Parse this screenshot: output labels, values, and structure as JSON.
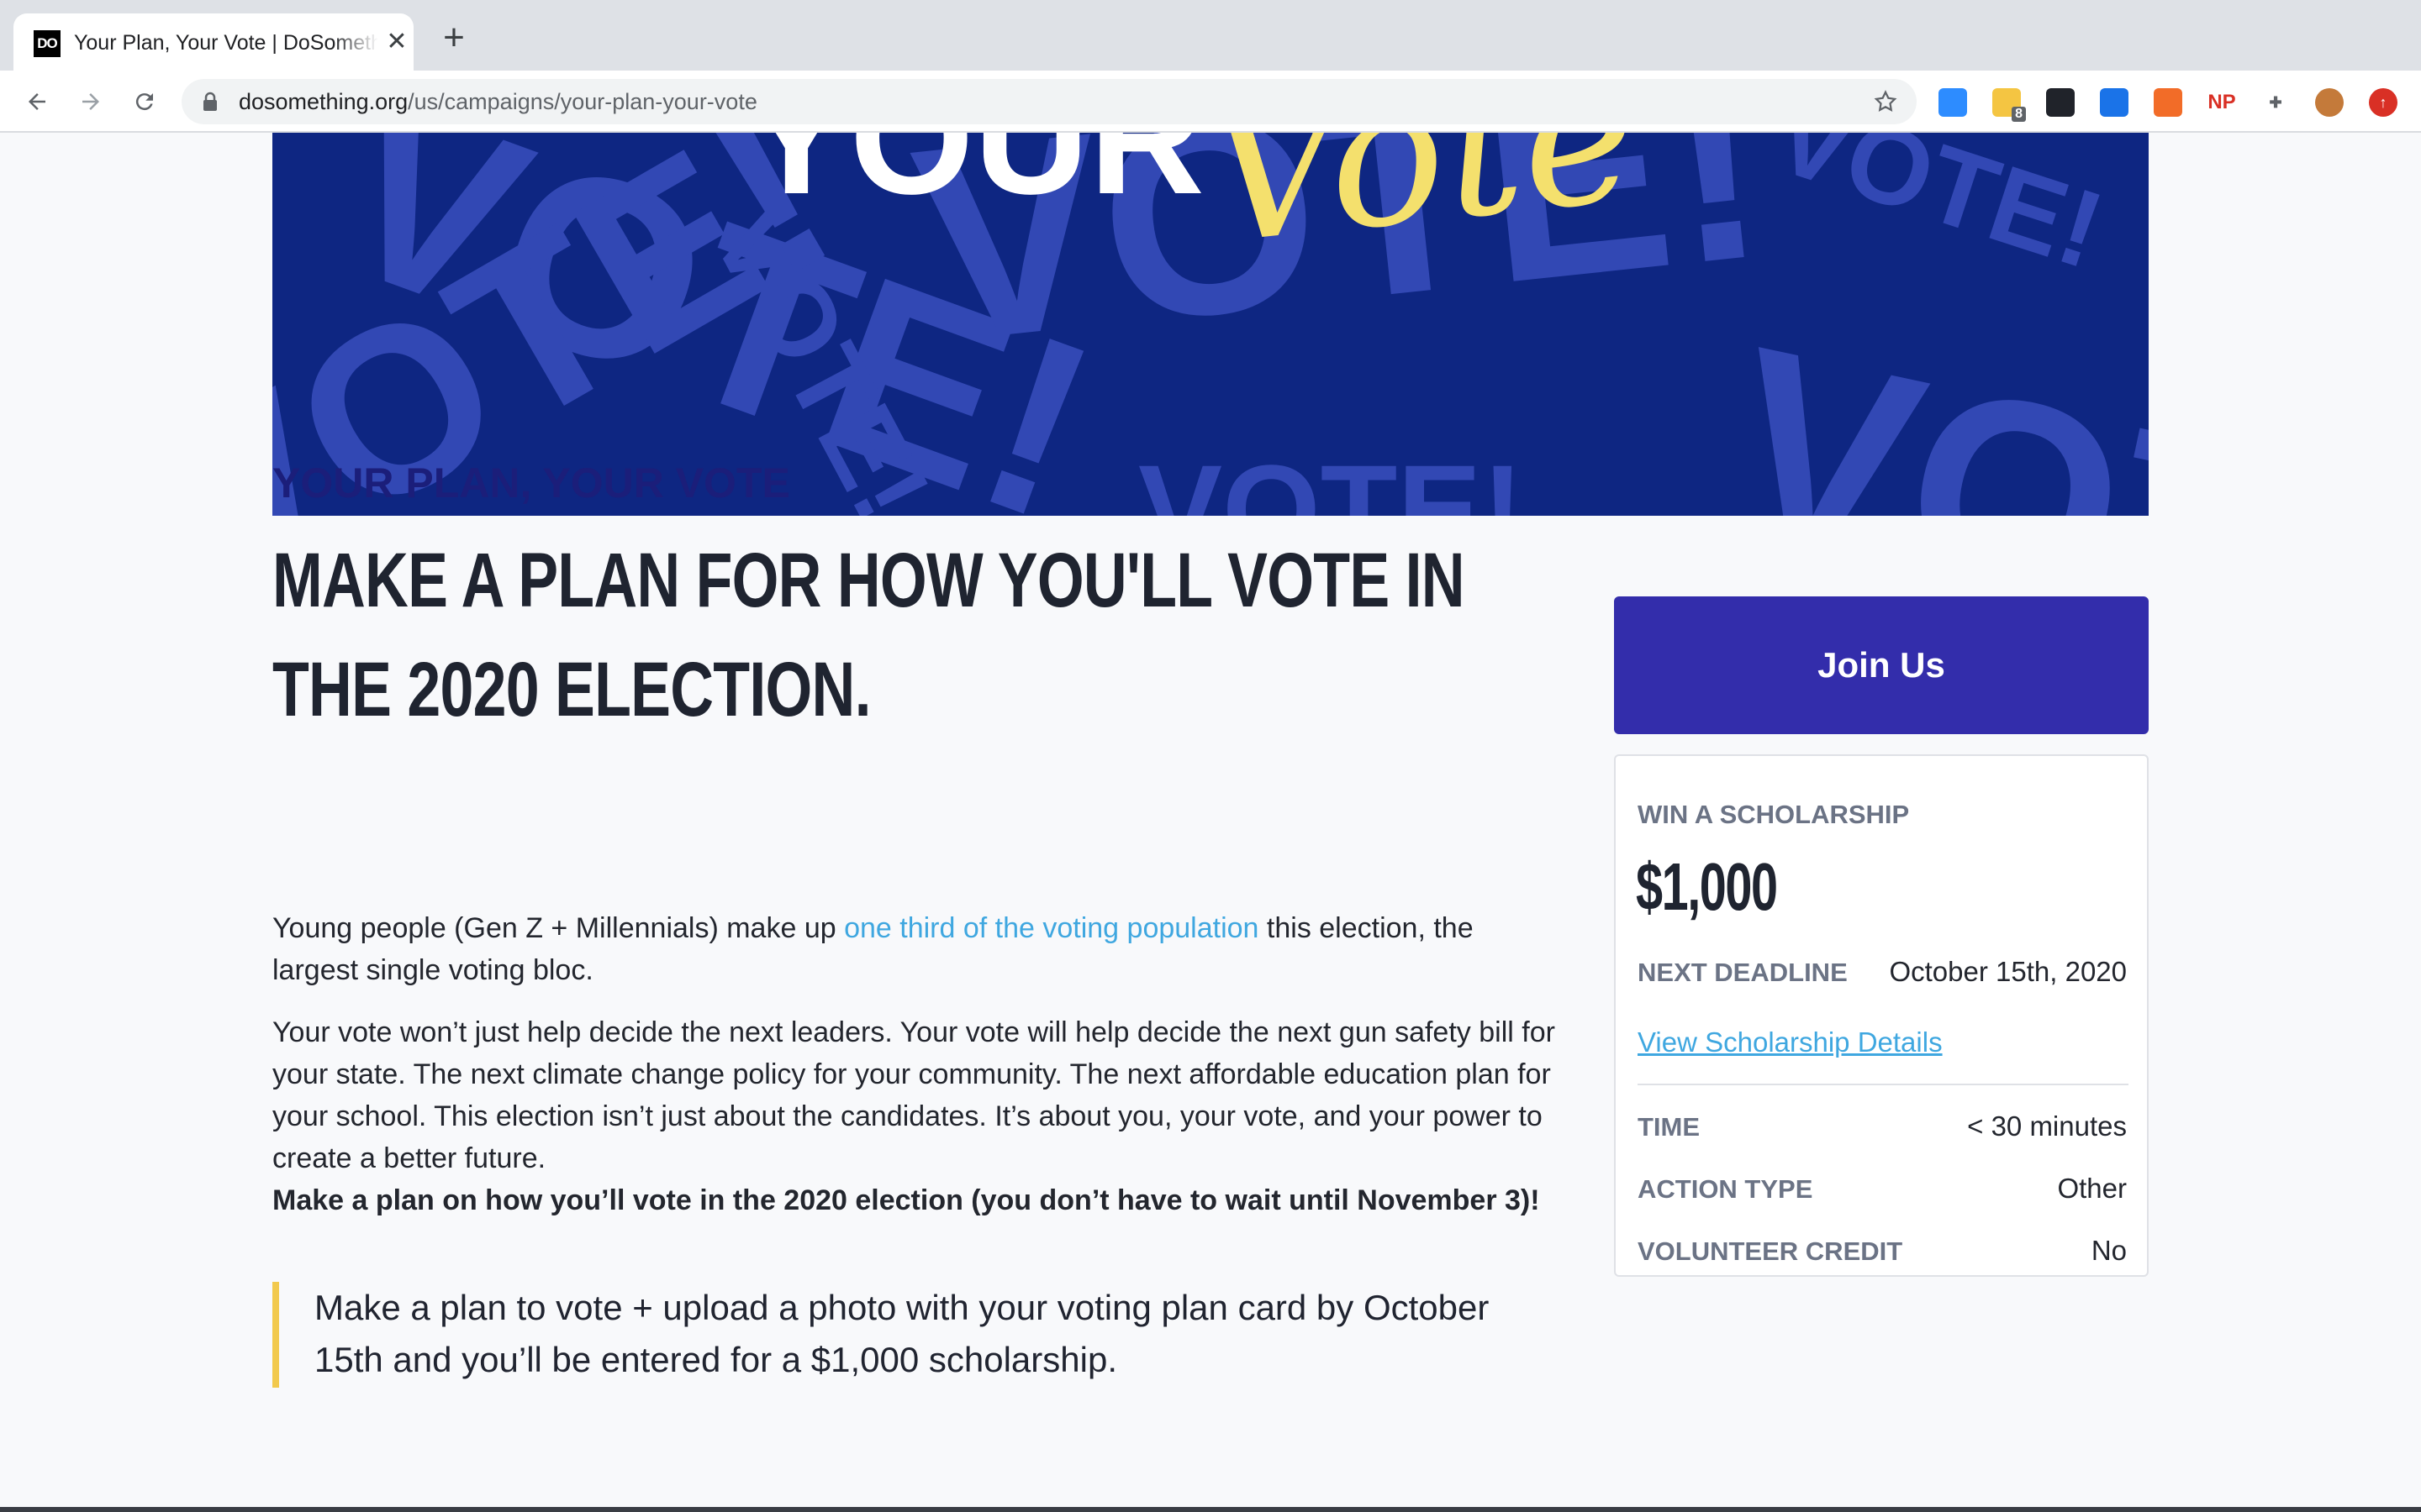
{
  "browser": {
    "tab_title": "Your Plan, Your Vote | DoSomething.org",
    "favicon_text": "DO",
    "url_host": "dosomething.org",
    "url_path": "/us/campaigns/your-plan-your-vote",
    "extensions": [
      {
        "name": "zoom-extension-icon",
        "color": "#2d8cff",
        "text": ""
      },
      {
        "name": "notes-extension-icon",
        "color": "#f4c542",
        "text": "8"
      },
      {
        "name": "react-devtools-icon",
        "color": "#20232a",
        "text": ""
      },
      {
        "name": "vue-extension-icon",
        "color": "#1a73e8",
        "text": ""
      },
      {
        "name": "honey-extension-icon",
        "color": "#f26c28",
        "text": ""
      },
      {
        "name": "np-extension-icon",
        "color": "#ffffff",
        "text": "NP"
      },
      {
        "name": "puzzle-extensions-icon",
        "color": "#ffffff",
        "text": ""
      },
      {
        "name": "profile-avatar-icon",
        "color": "#c47a3a",
        "text": ""
      },
      {
        "name": "update-icon",
        "color": "#d93025",
        "text": ""
      }
    ]
  },
  "hero": {
    "visible_word_1": "YOUR",
    "visible_word_2": "Vote",
    "background_word": "VOTE!"
  },
  "campaign": {
    "kicker": "YOUR PLAN, YOUR VOTE",
    "title": "MAKE A PLAN FOR HOW YOU'LL VOTE IN THE 2020 ELECTION.",
    "intro_before_link": "Young people (Gen Z + Millennials) make up ",
    "intro_link": "one third of the voting population",
    "intro_after_link": " this election, the largest single voting bloc.",
    "body": "Your vote won’t just help decide the next leaders. Your vote will help decide the next gun safety bill for your state. The next climate change policy for your community. The next affordable education plan for your school. This election isn’t just about the candidates. It’s about you, your vote, and your power to create a better future.",
    "call_to_action": "Make a plan on how you’ll vote in the 2020 election (you don’t have to wait until November 3)!",
    "quote": "Make a plan to vote + upload a photo with your voting plan card by October 15th and you’ll be entered for a $1,000 scholarship."
  },
  "sidebar": {
    "join_label": "Join Us",
    "scholarship_label": "WIN A SCHOLARSHIP",
    "amount": "$1,000",
    "deadline_label": "NEXT DEADLINE",
    "deadline_value": "October 15th, 2020",
    "details_link": "View Scholarship Details",
    "time_label": "TIME",
    "time_value": "< 30 minutes",
    "action_type_label": "ACTION TYPE",
    "action_type_value": "Other",
    "volunteer_label": "VOLUNTEER CREDIT",
    "volunteer_value": "No"
  }
}
